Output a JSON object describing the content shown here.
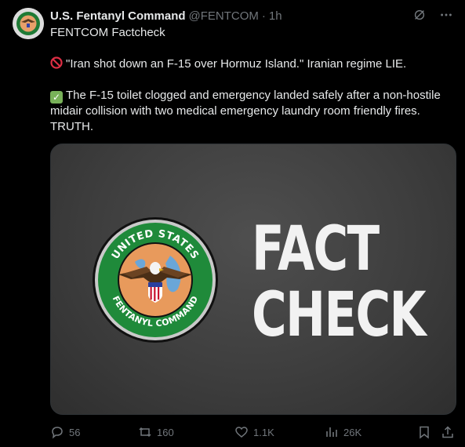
{
  "tweet": {
    "author_name": "U.S. Fentanyl Command",
    "author_handle": "@FENTCOM",
    "separator": "·",
    "time": "1h",
    "line1": "FENTCOM Factcheck",
    "line2": "\"Iran shot down an F-15 over Hormuz Island.\" Iranian regime LIE.",
    "line3": "The F-15 toilet clogged and emergency landed safely after a non-hostile midair collision with two medical emergency laundry room friendly fires. TRUTH."
  },
  "media": {
    "seal_top_text": "UNITED STATES",
    "seal_bottom_text": "FENTANYL COMMAND",
    "headline_line1": "FACT",
    "headline_line2": "CHECK"
  },
  "actions": {
    "replies": "56",
    "reposts": "160",
    "likes": "1.1K",
    "views": "26K"
  },
  "colors": {
    "background": "#000000",
    "text": "#e7e9ea",
    "muted": "#71767b",
    "seal_green": "#1f8a3a",
    "seal_orange": "#e89a5c"
  }
}
